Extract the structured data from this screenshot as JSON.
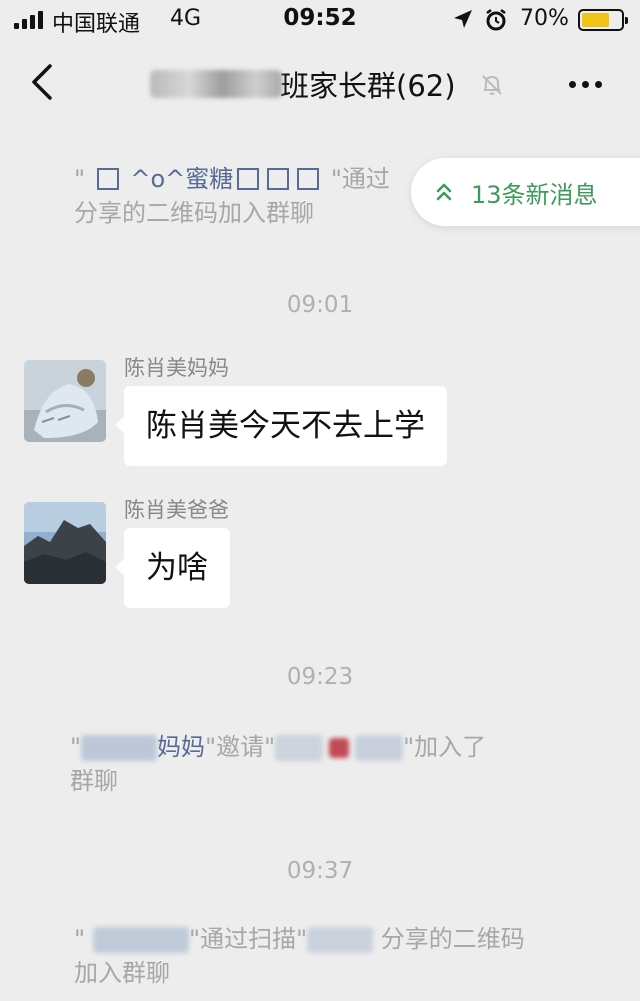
{
  "status_bar": {
    "carrier": "中国联通",
    "network": "4G",
    "time": "09:52",
    "battery_percent": "70%",
    "battery_level": 0.7
  },
  "nav": {
    "title_suffix": "班家长群(62)"
  },
  "new_messages": {
    "label": "13条新消息"
  },
  "notices": {
    "n1_quote_open": "\"",
    "n1_name": "^o^蜜糖",
    "n1_text": "\"通过",
    "n1_line2": "分享的二维码加入群聊",
    "n2_name": "妈妈",
    "n2_invite": "\"邀请\"",
    "n2_tail": "\"加入了",
    "n2_line2": "群聊",
    "n3_scan": "\"通过扫描\"",
    "n3_tail": "分享的二维码",
    "n3_line2": "加入群聊"
  },
  "times": {
    "t1": "09:01",
    "t2": "09:23",
    "t3": "09:37"
  },
  "messages": [
    {
      "sender": "陈肖美妈妈",
      "text": "陈肖美今天不去上学"
    },
    {
      "sender": "陈肖美爸爸",
      "text": "为啥"
    }
  ],
  "colors": {
    "background": "#ededed",
    "link": "#576b95",
    "notice_text": "#a7a7a7",
    "new_msg_green": "#3d9a5d",
    "battery": "#f0c419"
  },
  "icons": [
    "signal-icon",
    "location-icon",
    "alarm-icon",
    "battery-icon",
    "back-icon",
    "mute-bell-icon",
    "more-icon",
    "double-chevron-up-icon"
  ]
}
